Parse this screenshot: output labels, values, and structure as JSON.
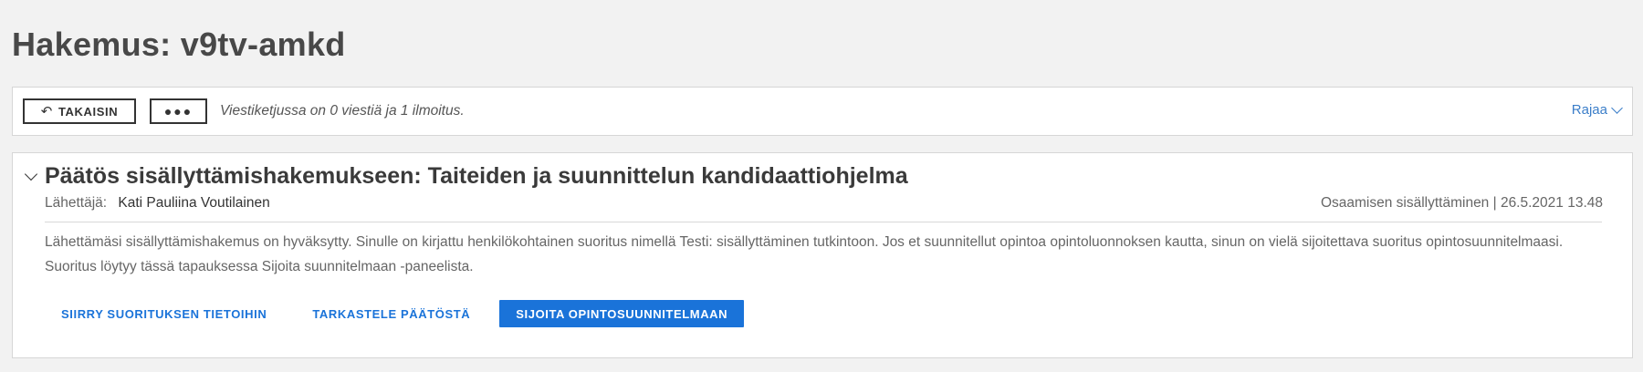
{
  "page": {
    "title": "Hakemus: v9tv-amkd"
  },
  "toolbar": {
    "back_label": "TAKAISIN",
    "back_icon": "undo-arrow-icon",
    "more_label": "●●●",
    "thread_info": "Viestiketjussa on 0 viestiä ja 1 ilmoitus.",
    "filter_label": "Rajaa"
  },
  "message": {
    "title": "Päätös sisällyttämishakemukseen: Taiteiden ja suunnittelun kandidaattiohjelma",
    "sender_label": "Lähettäjä:",
    "sender_name": "Kati Pauliina Voutilainen",
    "meta": "Osaamisen sisällyttäminen | 26.5.2021 13.48",
    "body": "Lähettämäsi sisällyttämishakemus on hyväksytty. Sinulle on kirjattu henkilökohtainen suoritus nimellä Testi: sisällyttäminen tutkintoon. Jos et suunnitellut opintoa opintoluonnoksen kautta, sinun on vielä sijoitettava suoritus opintosuunnitelmaasi. Suoritus löytyy tässä tapauksessa Sijoita suunnitelmaan -paneelista.",
    "actions": {
      "goto_label": "SIIRRY SUORITUKSEN TIETOIHIN",
      "view_label": "TARKASTELE PÄÄTÖSTÄ",
      "place_label": "SIJOITA OPINTOSUUNNITELMAAN"
    }
  },
  "colors": {
    "accent": "#1a73d9",
    "link": "#3b7ec9",
    "background": "#f2f2f2"
  }
}
